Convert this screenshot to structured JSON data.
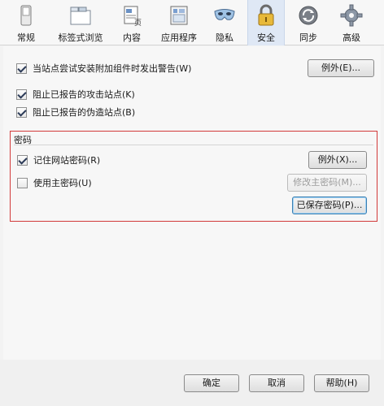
{
  "toolbar": {
    "tabs": [
      {
        "label": "常规",
        "icon": "switch-icon"
      },
      {
        "label": "标签式浏览",
        "icon": "tabs-icon"
      },
      {
        "label": "内容",
        "icon": "content-icon"
      },
      {
        "label": "应用程序",
        "icon": "applications-icon"
      },
      {
        "label": "隐私",
        "icon": "privacy-mask-icon"
      },
      {
        "label": "安全",
        "icon": "lock-icon"
      },
      {
        "label": "同步",
        "icon": "sync-icon"
      },
      {
        "label": "高级",
        "icon": "gear-icon"
      }
    ],
    "active_tab": "安全"
  },
  "security": {
    "warn_addons": {
      "label": "当站点尝试安装附加组件时发出警告(W)",
      "checked": true
    },
    "warn_exceptions_button": "例外(E)...",
    "block_attack": {
      "label": "阻止已报告的攻击站点(K)",
      "checked": true
    },
    "block_forgery": {
      "label": "阻止已报告的伪造站点(B)",
      "checked": true
    }
  },
  "passwords": {
    "title": "密码",
    "remember": {
      "label": "记住网站密码(R)",
      "checked": true
    },
    "remember_exceptions_button": "例外(X)...",
    "master": {
      "label": "使用主密码(U)",
      "checked": false
    },
    "change_master_button": "修改主密码(M)...",
    "saved_passwords_button": "已保存密码(P)..."
  },
  "footer": {
    "ok": "确定",
    "cancel": "取消",
    "help": "帮助(H)"
  },
  "colors": {
    "highlight_border": "#d23a3a",
    "active_tab_bg": "#dfe8f5"
  }
}
